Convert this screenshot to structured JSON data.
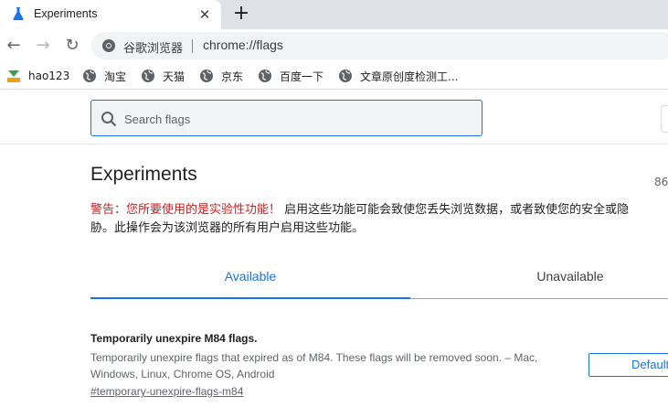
{
  "browser": {
    "tab": {
      "title": "Experiments",
      "favicon": "flask-icon",
      "close_glyph": "✕"
    },
    "new_tab_glyph": "+",
    "nav": {
      "back": "←",
      "forward": "→",
      "reload": "↻"
    },
    "omnibox": {
      "site_name": "谷歌浏览器",
      "url": "chrome://flags"
    },
    "bookmarks": [
      {
        "label": "hao123",
        "icon": "hao123-icon"
      },
      {
        "label": "淘宝",
        "icon": "globe-icon"
      },
      {
        "label": "天猫",
        "icon": "globe-icon"
      },
      {
        "label": "京东",
        "icon": "globe-icon"
      },
      {
        "label": "百度一下",
        "icon": "globe-icon"
      },
      {
        "label": "文章原创度检测工...",
        "icon": "globe-icon"
      }
    ]
  },
  "page": {
    "search": {
      "placeholder": "Search flags",
      "value": ""
    },
    "title": "Experiments",
    "version": "86",
    "warning": {
      "label": "警告：您所要使用的是实验性功能！",
      "text_line1": " 启用这些功能可能会致使您丢失浏览数据，或者致使您的安全或隐",
      "text_line2": "胁。此操作会为该浏览器的所有用户启用这些功能。"
    },
    "tabs": [
      {
        "label": "Available",
        "active": true
      },
      {
        "label": "Unavailable",
        "active": false
      }
    ],
    "flags": [
      {
        "name": "Temporarily unexpire M84 flags.",
        "description": "Temporarily unexpire flags that expired as of M84. These flags will be removed soon. – Mac, Windows, Linux, Chrome OS, Android",
        "link": "#temporary-unexpire-flags-m84",
        "selected": "Default"
      }
    ]
  },
  "colors": {
    "accent": "#1a73e8",
    "warning": "#c5221f",
    "tabstrip": "#dee1e6",
    "omnibox": "#f1f3f4"
  }
}
